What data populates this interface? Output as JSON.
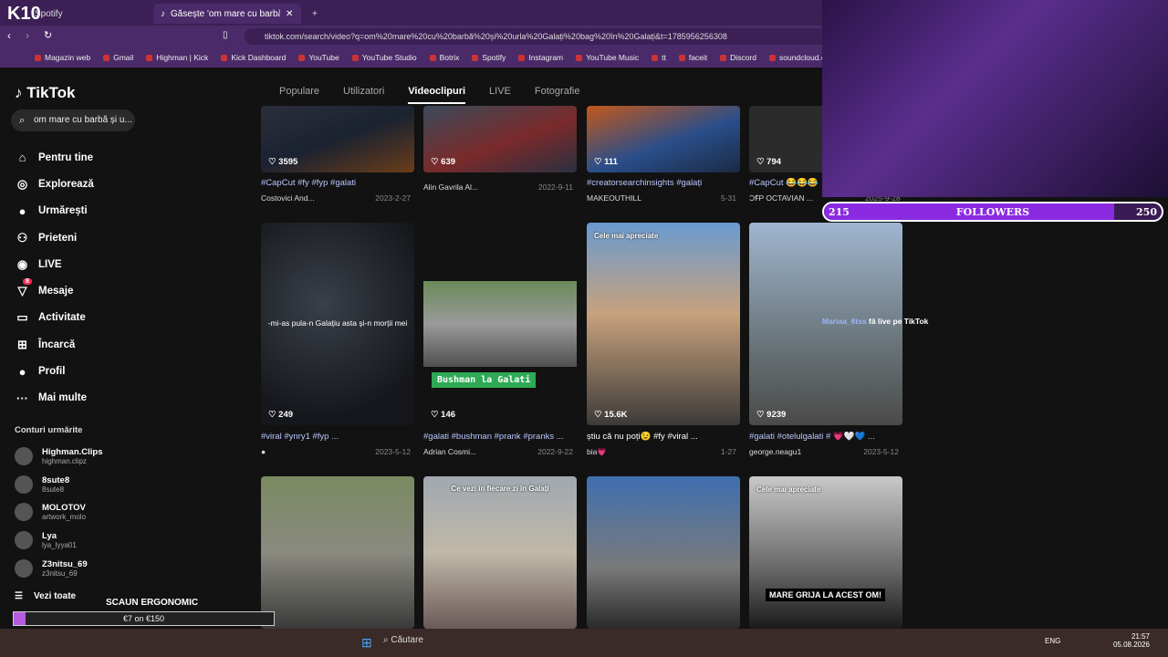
{
  "browser": {
    "logo": "K10",
    "tabs": [
      {
        "label": "Spotify",
        "active": false
      },
      {
        "label": "Găsește 'om mare cu barbă și ur...",
        "active": true
      }
    ],
    "url": "tiktok.com/search/video?q=om%20mare%20cu%20barbă%20și%20urla%20Galați%20bag%20în%20Galați&t=1785956256308",
    "bookmarks": [
      "Magazin web",
      "Gmail",
      "Highman | Kick",
      "Kick Dashboard",
      "YouTube",
      "YouTube Studio",
      "Botrix",
      "Spotify",
      "Instagram",
      "YouTube Music",
      "tt",
      "faceit",
      "Discord",
      "soundcloud.com/"
    ]
  },
  "sidebar": {
    "logo": "TikTok",
    "search_value": "om mare cu barbă și u...",
    "nav": [
      {
        "label": "Pentru tine",
        "icon": "home-icon"
      },
      {
        "label": "Explorează",
        "icon": "compass-icon"
      },
      {
        "label": "Urmărești",
        "icon": "following-icon"
      },
      {
        "label": "Prieteni",
        "icon": "friends-icon"
      },
      {
        "label": "LIVE",
        "icon": "live-icon"
      },
      {
        "label": "Mesaje",
        "icon": "messages-icon",
        "badge": "8"
      },
      {
        "label": "Activitate",
        "icon": "activity-icon"
      },
      {
        "label": "Încarcă",
        "icon": "upload-icon"
      },
      {
        "label": "Profil",
        "icon": "profile-icon"
      },
      {
        "label": "Mai multe",
        "icon": "more-icon"
      }
    ],
    "following_title": "Conturi urmărite",
    "accounts": [
      {
        "name": "Highman.Clips",
        "handle": "highman.clipz"
      },
      {
        "name": "8sute8",
        "handle": "8sute8"
      },
      {
        "name": "MOLOTOV",
        "handle": "artwork_molo"
      },
      {
        "name": "Lya",
        "handle": "lya_lyya01"
      },
      {
        "name": "Z3nitsu_69",
        "handle": "z3nitsu_69"
      }
    ],
    "see_all": "Vezi toate"
  },
  "tabs": [
    "Populare",
    "Utilizatori",
    "Videoclipuri",
    "LIVE",
    "Fotografie"
  ],
  "active_tab": "Videoclipuri",
  "videos_row1": [
    {
      "likes": "3595",
      "caption": "#CapCut #fy #fyp #galati",
      "author": "Costovici And...",
      "date": "2023-2-27"
    },
    {
      "likes": "639",
      "caption": "",
      "author": "Alin Gavrila Al...",
      "date": "2022-9-11"
    },
    {
      "likes": "111",
      "caption": "#creatorsearchinsights #galați",
      "author": "MAKEOUTHILL",
      "date": "5-31"
    },
    {
      "likes": "794",
      "caption": "#CapCut 😂😂😂",
      "author": "ƆꞘP OCTAVIAN ...",
      "date": "2025-9-28"
    }
  ],
  "videos_row2": [
    {
      "likes": "249",
      "caption": "#viral #ynry1 #fyp ...",
      "author": "",
      "date": "2023-5-12",
      "overlay": "-mi-as pula-n Galațiu asta și-n morții mei"
    },
    {
      "likes": "146",
      "caption": "#galati #bushman #prank #pranks ...",
      "author": "Adrian Cosmi...",
      "date": "2022-9-22",
      "overlay": "Bushman la Galati"
    },
    {
      "likes": "15.6K",
      "caption": "știu că nu poți😉 #fy #viral ...",
      "author": "bia💗",
      "date": "1-27",
      "badge": "Cele mai apreciate"
    },
    {
      "likes": "9239",
      "caption": "#galati #otelulgalati # 💗🤍💙 ...",
      "author": "george.neagu1",
      "date": "2023-5-12"
    }
  ],
  "videos_row3": [
    {
      "overlay": ""
    },
    {
      "overlay": "Ce vezi în fiecare zi în Galați"
    },
    {
      "overlay": ""
    },
    {
      "overlay": "MARE GRIJA LA ACEST OM!",
      "badge": "Cele mai apreciate"
    }
  ],
  "live_notice": {
    "user": "Mariaa_6tss",
    "text": "fă live pe TikTok"
  },
  "stream": {
    "followers_label": "FOLLOWERS",
    "followers_current": "215",
    "followers_goal": "250",
    "followers_fraction": 0.86,
    "seat_title": "SCAUN ERGONOMIC",
    "seat_text": "€7 on €150",
    "seat_fraction": 0.047
  },
  "taskbar": {
    "search": "Căutare",
    "lang": "ENG",
    "time": "21:57",
    "date": "05.08.2026"
  },
  "colors": {
    "tiktok_bg": "#121212",
    "browser": "#4a2a68",
    "followers_fill": "#8a2be2"
  }
}
